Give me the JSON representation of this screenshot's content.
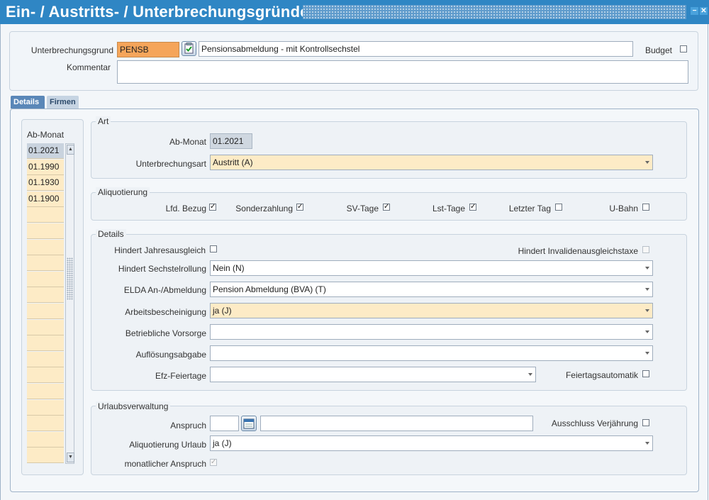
{
  "window": {
    "title": "Ein- / Austritts- / Unterbrechungsgründe",
    "minimize_label": "−",
    "close_label": "✕"
  },
  "header": {
    "unterbrechungsgrund_label": "Unterbrechungsgrund",
    "unterbrechungsgrund_code": "PENSB",
    "unterbrechungsgrund_text": "Pensionsabmeldung - mit Kontrollsechstel",
    "budget_label": "Budget",
    "budget_checked": false,
    "kommentar_label": "Kommentar",
    "kommentar_value": ""
  },
  "tabs": [
    {
      "label": "Details",
      "active": true
    },
    {
      "label": "Firmen",
      "active": false
    }
  ],
  "ab_monat_list": {
    "header": "Ab-Monat",
    "rows": [
      "01.2021",
      "01.1990",
      "01.1930",
      "01.1900",
      "",
      "",
      "",
      "",
      "",
      "",
      "",
      "",
      "",
      "",
      "",
      "",
      "",
      "",
      "",
      ""
    ]
  },
  "art": {
    "title": "Art",
    "ab_monat_label": "Ab-Monat",
    "ab_monat_value": "01.2021",
    "unterbrechungsart_label": "Unterbrechungsart",
    "unterbrechungsart_value": "Austritt (A)"
  },
  "aliquotierung": {
    "title": "Aliquotierung",
    "items": [
      {
        "label": "Lfd. Bezug",
        "checked": true
      },
      {
        "label": "Sonderzahlung",
        "checked": true
      },
      {
        "label": "SV-Tage",
        "checked": true
      },
      {
        "label": "Lst-Tage",
        "checked": true
      },
      {
        "label": "Letzter Tag",
        "checked": false
      },
      {
        "label": "U-Bahn",
        "checked": false
      }
    ]
  },
  "details": {
    "title": "Details",
    "hindert_jahresausgleich_label": "Hindert Jahresausgleich",
    "hindert_invalidenausgleichstaxe_label": "Hindert Invalidenausgleichstaxe",
    "hindert_sechstelrollung_label": "Hindert Sechstelrollung",
    "hindert_sechstelrollung_value": "Nein (N)",
    "elda_label": "ELDA An-/Abmeldung",
    "elda_value": "Pension Abmeldung (BVA) (T)",
    "arbeitsbescheinigung_label": "Arbeitsbescheinigung",
    "arbeitsbescheinigung_value": "ja (J)",
    "betriebliche_vorsorge_label": "Betriebliche Vorsorge",
    "betriebliche_vorsorge_value": "",
    "aufloesungsabgabe_label": "Auflösungsabgabe",
    "aufloesungsabgabe_value": "",
    "efz_feiertage_label": "Efz-Feiertage",
    "efz_feiertage_value": "",
    "feiertagsautomatik_label": "Feiertagsautomatik"
  },
  "urlaub": {
    "title": "Urlaubsverwaltung",
    "anspruch_label": "Anspruch",
    "anspruch_value": "",
    "anspruch_text": "",
    "ausschluss_label": "Ausschluss Verjährung",
    "aliquotierung_urlaub_label": "Aliquotierung Urlaub",
    "aliquotierung_urlaub_value": "ja (J)",
    "monatlicher_anspruch_label": "monatlicher Anspruch",
    "monatlicher_anspruch_checked": true
  },
  "colors": {
    "titlebar": "#2f86c4",
    "highlight_yellow": "#fdebc6",
    "code_orange": "#f5a55a",
    "active_tab": "#5a87b8"
  }
}
